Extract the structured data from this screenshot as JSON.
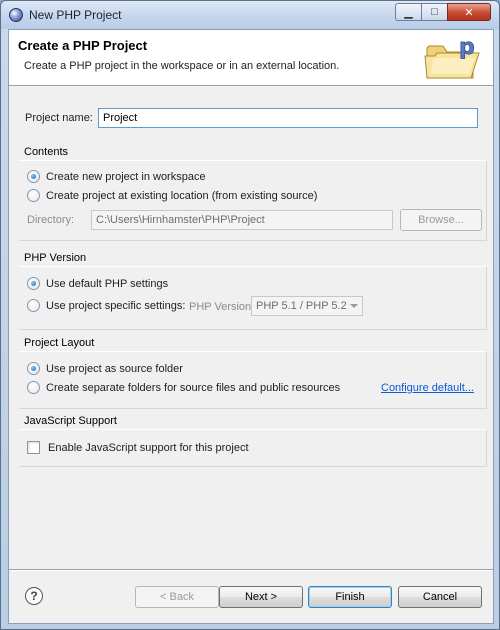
{
  "window": {
    "title": "New PHP Project"
  },
  "header": {
    "title": "Create a PHP Project",
    "description": "Create a PHP project in the workspace or in an external location."
  },
  "project_name": {
    "label": "Project name:",
    "value": "Project"
  },
  "contents": {
    "title": "Contents",
    "option_workspace": "Create new project in workspace",
    "option_existing": "Create project at existing location (from existing source)",
    "selected": "workspace",
    "directory_label": "Directory:",
    "directory_value": "C:\\Users\\Hirnhamster\\PHP\\Project",
    "browse_label": "Browse..."
  },
  "php_version": {
    "title": "PHP Version",
    "option_default": "Use default PHP settings",
    "option_specific": "Use project specific settings:",
    "selected": "default",
    "version_label": "PHP Version:",
    "version_value": "PHP 5.1 / PHP 5.2"
  },
  "project_layout": {
    "title": "Project Layout",
    "option_source": "Use project as source folder",
    "option_separate": "Create separate folders for source files and public resources",
    "selected": "source",
    "configure_link": "Configure default..."
  },
  "javascript": {
    "title": "JavaScript Support",
    "enable_label": "Enable JavaScript support for this project",
    "enabled": false
  },
  "footer": {
    "back_label": "< Back",
    "next_label": "Next >",
    "finish_label": "Finish",
    "cancel_label": "Cancel",
    "help_glyph": "?"
  },
  "icons": {
    "window": "eclipse-icon",
    "wizard": "php-folder-icon",
    "help": "help-icon"
  },
  "colors": {
    "link": "#0b5bd3",
    "focus": "#5a9bd5",
    "titlebar": "#c7d8ee",
    "close": "#c94b32"
  }
}
